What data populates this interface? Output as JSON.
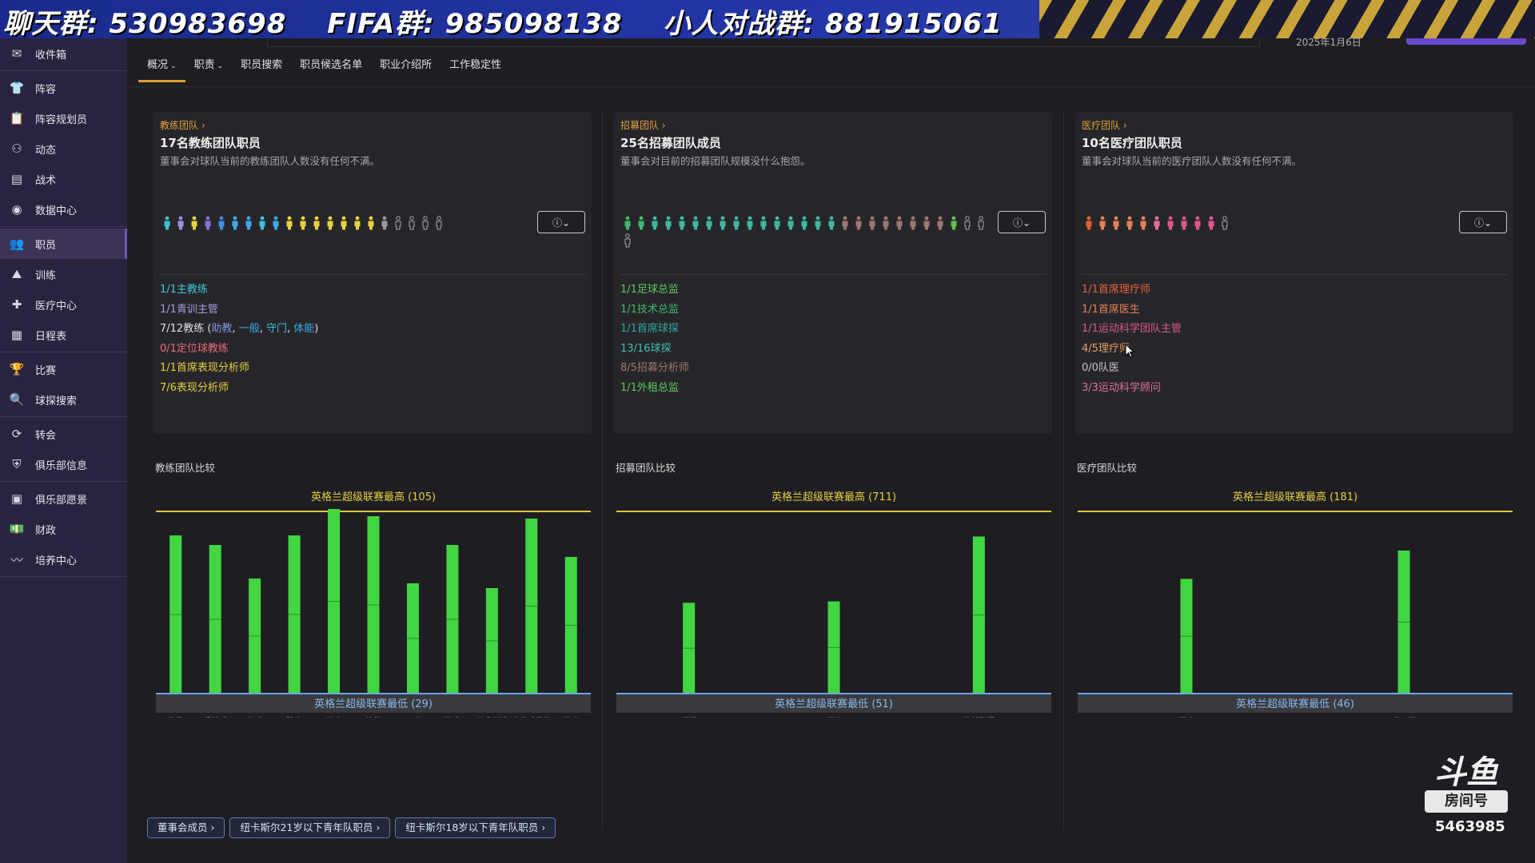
{
  "banner": {
    "items": [
      "聊天群: 530983698",
      "FIFA群: 985098138",
      "小人对战群: 881915061"
    ]
  },
  "top": {
    "date": "2025年1月6日"
  },
  "sidebar": {
    "items": [
      {
        "label": "收件箱",
        "icon": "inbox-icon",
        "glyph": "✉"
      },
      {
        "label": "阵容",
        "icon": "shirt-icon",
        "glyph": "👕"
      },
      {
        "label": "阵容规划员",
        "icon": "clipboard-icon",
        "glyph": "📋"
      },
      {
        "label": "动态",
        "icon": "dynamics-icon",
        "glyph": "⚇"
      },
      {
        "label": "战术",
        "icon": "tactics-icon",
        "glyph": "▤"
      },
      {
        "label": "数据中心",
        "icon": "data-hub-icon",
        "glyph": "◉"
      },
      {
        "label": "职员",
        "icon": "staff-icon",
        "glyph": "👥"
      },
      {
        "label": "训练",
        "icon": "training-icon",
        "glyph": "⛰"
      },
      {
        "label": "医疗中心",
        "icon": "medical-icon",
        "glyph": "✚"
      },
      {
        "label": "日程表",
        "icon": "calendar-icon",
        "glyph": "▦"
      },
      {
        "label": "比赛",
        "icon": "trophy-icon",
        "glyph": "🏆"
      },
      {
        "label": "球探搜索",
        "icon": "search-icon",
        "glyph": "🔍"
      },
      {
        "label": "转会",
        "icon": "transfer-icon",
        "glyph": "⟳"
      },
      {
        "label": "俱乐部信息",
        "icon": "shield-icon",
        "glyph": "⛨"
      },
      {
        "label": "俱乐部愿景",
        "icon": "vision-icon",
        "glyph": "▣"
      },
      {
        "label": "财政",
        "icon": "finance-icon",
        "glyph": "💵"
      },
      {
        "label": "培养中心",
        "icon": "development-icon",
        "glyph": "〰"
      }
    ]
  },
  "tabs": [
    {
      "label": "概况",
      "dropdown": true,
      "active": true
    },
    {
      "label": "职责",
      "dropdown": true
    },
    {
      "label": "职员搜索"
    },
    {
      "label": "职员候选名单"
    },
    {
      "label": "职业介绍所"
    },
    {
      "label": "工作稳定性"
    }
  ],
  "cards": [
    {
      "crumb": "教练团队 ›",
      "title": "17名教练团队职员",
      "desc": "董事会对球队当前的教练团队人数没有任何不满。",
      "filter_icon": "ⓘ⌄",
      "figures": [
        "#3fc0d0",
        "#a090e0",
        "#e8d040",
        "#8a70d8",
        "#4090e0",
        "#40a8e8",
        "#40a8e8",
        "#40c0d8",
        "#40a8e8",
        "#e8d040",
        "#e8d040",
        "#e8d040",
        "#e8d040",
        "#e8d040",
        "#e8d040",
        "#e8d040",
        "#999999",
        "#999999",
        "#999999",
        "#999999",
        "#999999"
      ],
      "figure_outline_from": 17,
      "roles": [
        {
          "text": "1/1主教练",
          "color": "#40c8d8"
        },
        {
          "text": "1/1青训主管",
          "color": "#a898e0"
        },
        {
          "text": "7/12教练 (",
          "color": "#e0e0e0",
          "extra": [
            "助教",
            "一般",
            "守门",
            "体能"
          ]
        },
        {
          "text": "0/1定位球教练",
          "color": "#e86a7a"
        },
        {
          "text": "1/1首席表现分析师",
          "color": "#e8d040"
        },
        {
          "text": "7/6表现分析师",
          "color": "#e8d040"
        }
      ]
    },
    {
      "crumb": "招募团队 ›",
      "title": "25名招募团队成员",
      "desc": "董事会对目前的招募团队规模没什么抱怨。",
      "filter_icon": "ⓘ⌄",
      "figures": [
        "#40b870",
        "#40b870",
        "#40b8a0",
        "#40b8a0",
        "#40b8a0",
        "#40b8a0",
        "#40b8a0",
        "#40b8a0",
        "#40b8a0",
        "#40b8a0",
        "#40b8a0",
        "#40b8a0",
        "#40b8a0",
        "#40b8a0",
        "#40b8a0",
        "#40b8a0",
        "#a07870",
        "#a07870",
        "#a07870",
        "#a07870",
        "#a07870",
        "#a07870",
        "#a07870",
        "#a07870",
        "#60c050",
        "#999999",
        "#999999",
        "#999999"
      ],
      "figure_outline_from": 25,
      "roles": [
        {
          "text": "1/1足球总监",
          "color": "#60c860"
        },
        {
          "text": "1/1技术总监",
          "color": "#40b870"
        },
        {
          "text": "1/1首席球探",
          "color": "#30a8a0"
        },
        {
          "text": "13/16球探",
          "color": "#40c0b0"
        },
        {
          "text": "8/5招募分析师",
          "color": "#a07870"
        },
        {
          "text": "1/1外租总监",
          "color": "#60c860"
        }
      ]
    },
    {
      "crumb": "医疗团队 ›",
      "title": "10名医疗团队职员",
      "desc": "董事会对球队当前的医疗团队人数没有任何不满。",
      "filter_icon": "ⓘ⌄",
      "figures": [
        "#e86030",
        "#e8805a",
        "#e8805a",
        "#e8805a",
        "#e8805a",
        "#e070a0",
        "#e05890",
        "#e05890",
        "#e05890",
        "#e05890",
        "#999999"
      ],
      "figure_outline_from": 10,
      "roles": [
        {
          "text": "1/1首席理疗师",
          "color": "#e8603a"
        },
        {
          "text": "1/1首席医生",
          "color": "#e8805a"
        },
        {
          "text": "1/1运动科学团队主管",
          "color": "#e05890"
        },
        {
          "text": "4/5理疗师",
          "color": "#e8a060"
        },
        {
          "text": "0/0队医",
          "color": "#c8c8c8"
        },
        {
          "text": "3/3运动科学顾问",
          "color": "#e070a0"
        }
      ]
    }
  ],
  "compare": [
    {
      "title": "教练团队比较"
    },
    {
      "title": "招募团队比较"
    },
    {
      "title": "医疗团队比较"
    }
  ],
  "chart_data": [
    {
      "type": "bar",
      "title": "英格兰超级联赛最高 (105)",
      "bottom_label": "英格兰超级联赛最低 (29)",
      "categories": [
        "扑救",
        "手控球",
        "分球",
        "防守",
        "进攻",
        "体能",
        "心理",
        "技术",
        "战术训练",
        "定位球教练",
        "管理"
      ],
      "values": [
        95,
        91,
        77,
        95,
        106,
        103,
        75,
        91,
        73,
        102,
        86
      ],
      "ylim": [
        29,
        105
      ]
    },
    {
      "type": "bar",
      "title": "英格兰超级联赛最高 (711)",
      "bottom_label": "英格兰超级联赛最低 (51)",
      "categories": [
        "评潜",
        "评价",
        "分析数据"
      ],
      "values": [
        380,
        385,
        620
      ],
      "ylim": [
        51,
        711
      ]
    },
    {
      "type": "bar",
      "title": "英格兰超级联赛最高 (181)",
      "bottom_label": "英格兰超级联赛最低 (46)",
      "categories": [
        "医疗",
        "运动学"
      ],
      "values": [
        131,
        152
      ],
      "ylim": [
        46,
        181
      ]
    }
  ],
  "bottom_buttons": [
    "董事会成员 ›",
    "纽卡斯尔21岁以下青年队职员 ›",
    "纽卡斯尔18岁以下青年队职员 ›"
  ],
  "watermark": {
    "logo": "斗鱼",
    "box": "房间号",
    "room": "5463985"
  },
  "colors": {
    "bar": "#43d643",
    "max_line": "#e0c840",
    "min_line": "#6aa8e8",
    "accent": "#e0a030"
  }
}
